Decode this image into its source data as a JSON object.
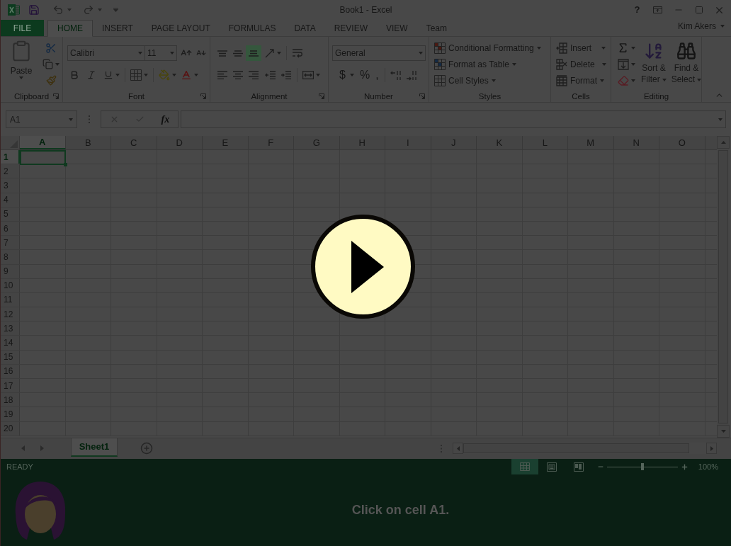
{
  "window": {
    "title": "Book1 - Excel",
    "help": "?",
    "user": "Kim Akers"
  },
  "tabs": [
    {
      "label": "FILE",
      "kind": "file",
      "selected": false
    },
    {
      "label": "HOME",
      "kind": "tab",
      "selected": true
    },
    {
      "label": "INSERT",
      "kind": "tab",
      "selected": false
    },
    {
      "label": "PAGE LAYOUT",
      "kind": "tab",
      "selected": false
    },
    {
      "label": "FORMULAS",
      "kind": "tab",
      "selected": false
    },
    {
      "label": "DATA",
      "kind": "tab",
      "selected": false
    },
    {
      "label": "REVIEW",
      "kind": "tab",
      "selected": false
    },
    {
      "label": "VIEW",
      "kind": "tab",
      "selected": false
    },
    {
      "label": "Team",
      "kind": "tab",
      "selected": false
    }
  ],
  "ribbon": {
    "groups": [
      {
        "kind": "clipboard",
        "label": "Clipboard",
        "launcher": true,
        "paste": "Paste"
      },
      {
        "kind": "font",
        "label": "Font",
        "launcher": true,
        "font_name": "Calibri",
        "font_size": "11"
      },
      {
        "kind": "alignment",
        "label": "Alignment",
        "launcher": true,
        "vertical_align": [
          {
            "kind": "top",
            "selected": false
          },
          {
            "kind": "middle",
            "selected": false
          },
          {
            "kind": "bottom",
            "selected": true
          }
        ],
        "horizontal_align": [
          {
            "kind": "left",
            "selected": false
          },
          {
            "kind": "center",
            "selected": false
          },
          {
            "kind": "right",
            "selected": false
          }
        ]
      },
      {
        "kind": "number",
        "label": "Number",
        "launcher": true,
        "format": "General",
        "symbols": [
          "$",
          "%",
          ","
        ]
      },
      {
        "kind": "styles",
        "label": "Styles",
        "launcher": false,
        "items": [
          "Conditional Formatting",
          "Format as Table",
          "Cell Styles"
        ]
      },
      {
        "kind": "cells",
        "label": "Cells",
        "launcher": false,
        "items": [
          "Insert",
          "Delete",
          "Format"
        ]
      },
      {
        "kind": "editing",
        "label": "Editing",
        "launcher": false,
        "items": [
          "Sort & Filter",
          "Find & Select"
        ]
      }
    ]
  },
  "formula_bar": {
    "name_box": "A1",
    "function_label": "fx"
  },
  "sheet": {
    "columns": [
      {
        "label": "A",
        "selected": true
      },
      {
        "label": "B",
        "selected": false
      },
      {
        "label": "C",
        "selected": false
      },
      {
        "label": "D",
        "selected": false
      },
      {
        "label": "E",
        "selected": false
      },
      {
        "label": "F",
        "selected": false
      },
      {
        "label": "G",
        "selected": false
      },
      {
        "label": "H",
        "selected": false
      },
      {
        "label": "I",
        "selected": false
      },
      {
        "label": "J",
        "selected": false
      },
      {
        "label": "K",
        "selected": false
      },
      {
        "label": "L",
        "selected": false
      },
      {
        "label": "M",
        "selected": false
      },
      {
        "label": "N",
        "selected": false
      },
      {
        "label": "O",
        "selected": false
      }
    ],
    "rows": [
      {
        "label": "1",
        "selected": true
      },
      {
        "label": "2",
        "selected": false
      },
      {
        "label": "3",
        "selected": false
      },
      {
        "label": "4",
        "selected": false
      },
      {
        "label": "5",
        "selected": false
      },
      {
        "label": "6",
        "selected": false
      },
      {
        "label": "7",
        "selected": false
      },
      {
        "label": "8",
        "selected": false
      },
      {
        "label": "9",
        "selected": false
      },
      {
        "label": "10",
        "selected": false
      },
      {
        "label": "11",
        "selected": false
      },
      {
        "label": "12",
        "selected": false
      },
      {
        "label": "13",
        "selected": false
      },
      {
        "label": "14",
        "selected": false
      },
      {
        "label": "15",
        "selected": false
      },
      {
        "label": "16",
        "selected": false
      },
      {
        "label": "17",
        "selected": false
      },
      {
        "label": "18",
        "selected": false
      },
      {
        "label": "19",
        "selected": false
      },
      {
        "label": "20",
        "selected": false
      }
    ]
  },
  "sheet_tabs": [
    {
      "label": "Sheet1",
      "selected": true
    }
  ],
  "status_bar": {
    "status": "READY",
    "views": [
      {
        "kind": "normal",
        "selected": true
      },
      {
        "kind": "page_layout",
        "selected": false
      },
      {
        "kind": "page_break_preview",
        "selected": false
      }
    ],
    "zoom": {
      "level": 0.5,
      "reading": "100%"
    }
  },
  "tutorial": {
    "instruction": "Click on cell A1."
  }
}
